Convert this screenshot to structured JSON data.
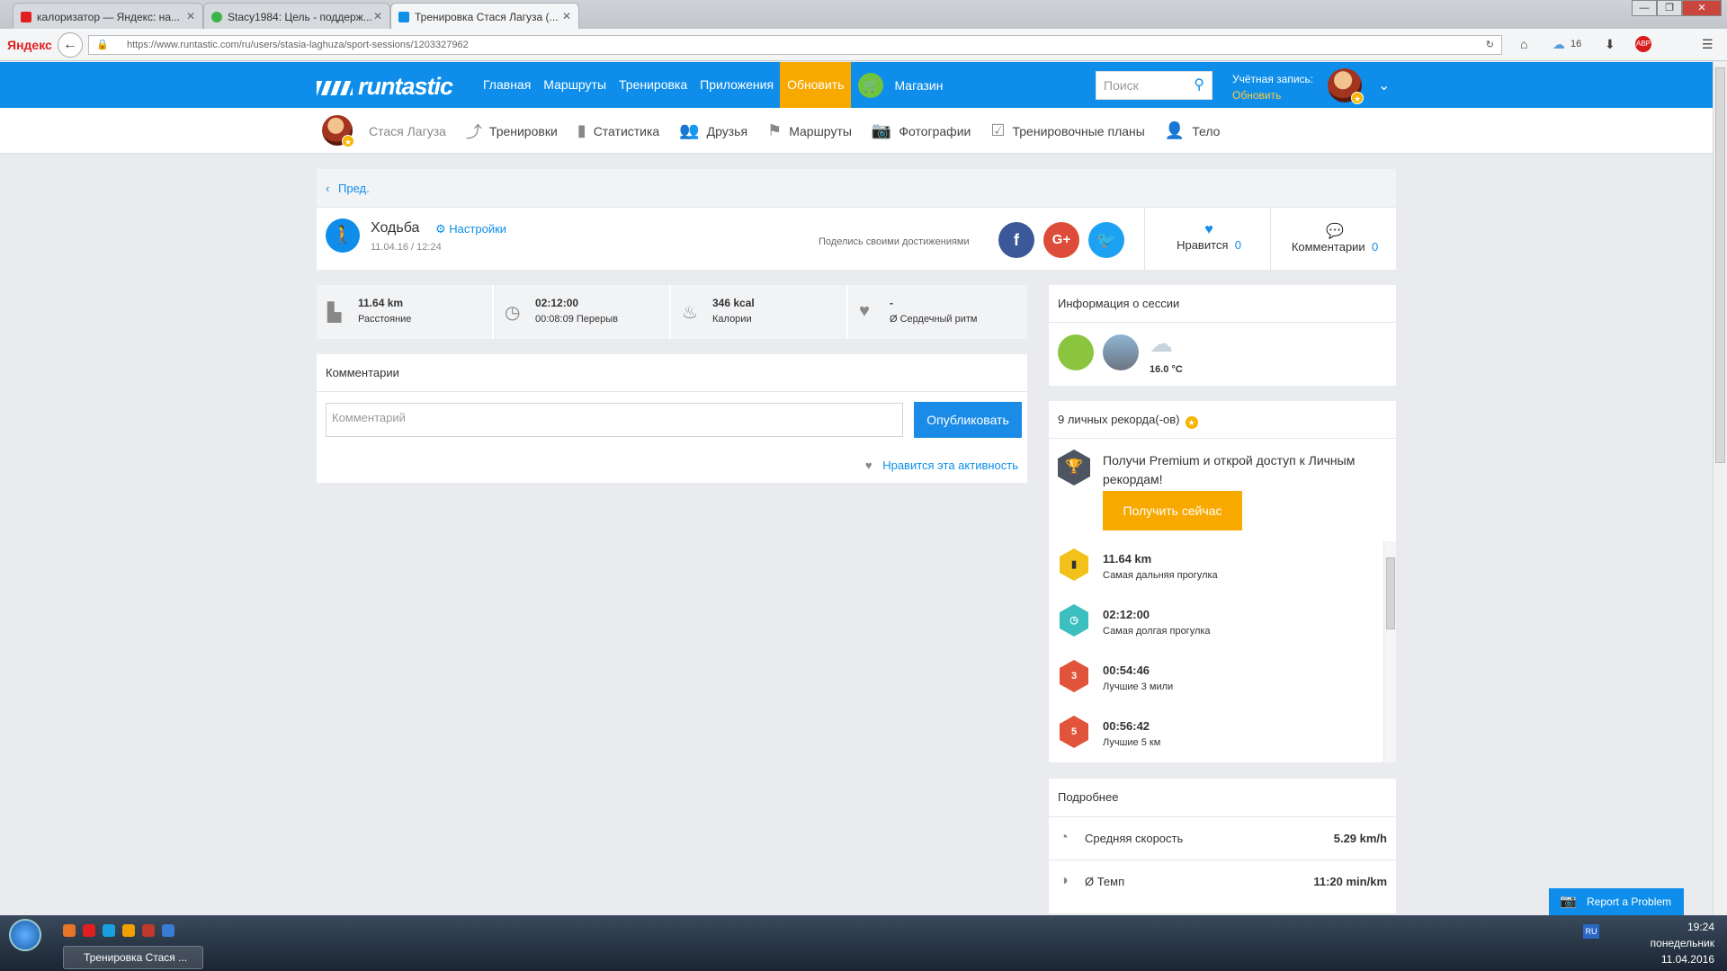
{
  "browser": {
    "tabs": [
      {
        "title": "калоризатор — Яндекс: на..."
      },
      {
        "title": "Stacy1984: Цель - поддерж..."
      },
      {
        "title": "Тренировка Стася Лагуза (..."
      }
    ],
    "yandex_logo": "Яндекс",
    "url": "https://www.runtastic.com/ru/users/stasia-laghuza/sport-sessions/1203327962",
    "cloud_count": "16",
    "abp_label": "ABP"
  },
  "header": {
    "brand": "runtastic",
    "nav": [
      "Главная",
      "Маршруты",
      "Тренировка",
      "Приложения"
    ],
    "update_label": "Обновить",
    "shop_label": "Магазин",
    "search_placeholder": "Поиск",
    "account_label": "Учётная запись:",
    "account_upgrade": "Обновить"
  },
  "subnav": {
    "user_name": "Стася Лагуза",
    "items": [
      "Тренировки",
      "Статистика",
      "Друзья",
      "Маршруты",
      "Фотографии",
      "Тренировочные планы",
      "Тело"
    ]
  },
  "activity": {
    "prev_label": "Пред.",
    "type": "Ходьба",
    "settings_label": "Настройки",
    "datetime": "11.04.16 / 12:24",
    "share_text": "Поделись своими достижениями",
    "likes_label": "Нравится",
    "likes_count": "0",
    "comments_label": "Комментарии",
    "comments_count": "0"
  },
  "stats": [
    {
      "icon": "road-icon",
      "value": "11.64 km",
      "label": "Расстояние"
    },
    {
      "icon": "timer-icon",
      "value": "02:12:00",
      "label": "00:08:09 Перерыв"
    },
    {
      "icon": "flame-icon",
      "value": "346 kcal",
      "label": "Калории"
    },
    {
      "icon": "heart-icon",
      "value": "-",
      "label": "Ø Сердечный ритм"
    }
  ],
  "comments_card": {
    "title": "Комментарии",
    "placeholder": "Комментарий",
    "publish_label": "Опубликовать",
    "like_activity": "Нравится эта активность"
  },
  "session_info": {
    "title": "Информация о сессии",
    "temperature": "16.0 °C"
  },
  "records": {
    "title": "9 личных рекорда(-ов)",
    "premium_text": "Получи Premium и открой доступ к Личным рекордам!",
    "get_now_label": "Получить сейчас",
    "items": [
      {
        "value": "11.64 km",
        "label": "Самая дальняя прогулка",
        "color": "#f2c21a"
      },
      {
        "value": "02:12:00",
        "label": "Самая долгая прогулка",
        "color": "#3bbfbf"
      },
      {
        "value": "00:54:46",
        "label": "Лучшие 3 мили",
        "color": "#e2533b"
      },
      {
        "value": "00:56:42",
        "label": "Лучшие 5 км",
        "color": "#e2533b"
      }
    ]
  },
  "details": {
    "title": "Подробнее",
    "rows": [
      {
        "label": "Средняя скорость",
        "value": "5.29 km/h"
      },
      {
        "label": "Ø Темп",
        "value": "11:20 min/km"
      }
    ]
  },
  "report_label": "Report a Problem",
  "taskbar": {
    "task_title": "Тренировка Стася ...",
    "lang": "RU",
    "time": "19:24",
    "day": "понедельник",
    "date": "11.04.2016"
  },
  "colors": {
    "brand_blue": "#0e8eea",
    "update_orange": "#f7a900",
    "shop_green": "#6fc33d"
  }
}
